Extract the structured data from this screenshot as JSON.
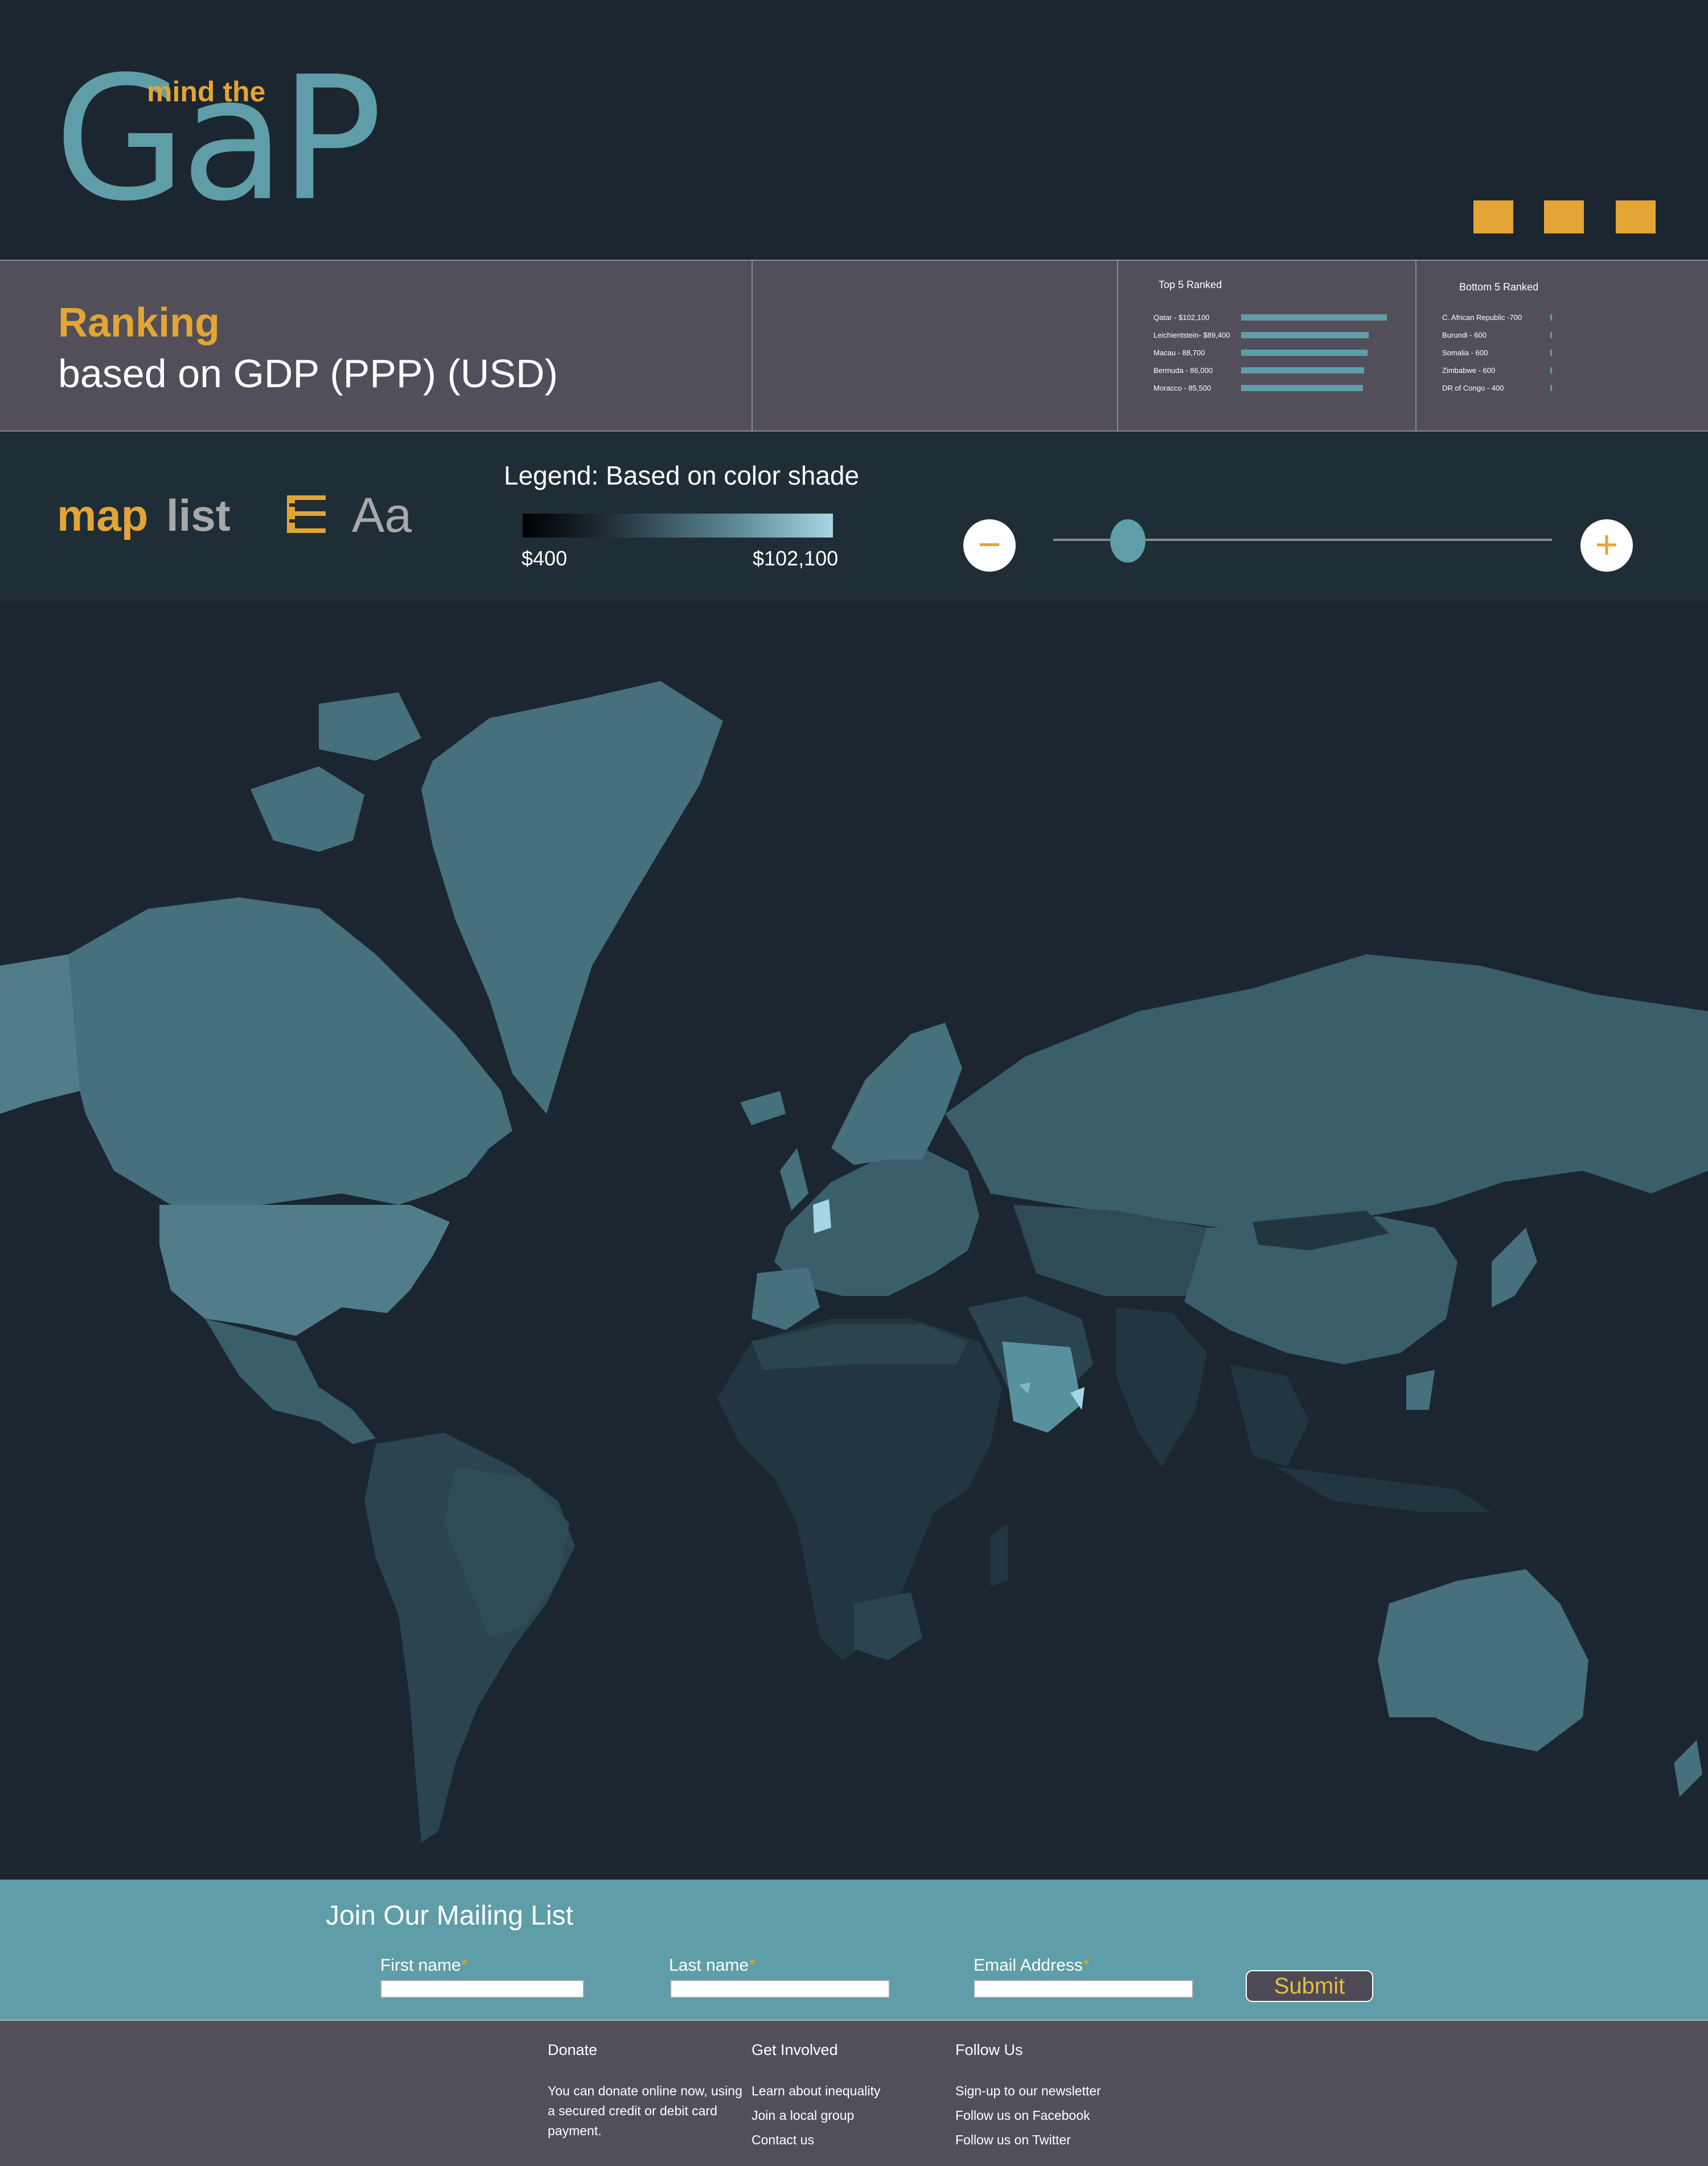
{
  "header": {
    "logo_main": "GaP",
    "logo_small": "mind the",
    "square_color": "#e3a535"
  },
  "ranking": {
    "title": "Ranking",
    "subtitle": "based on GDP (PPP) (USD)",
    "top": {
      "title": "Top 5 Ranked",
      "items": [
        {
          "label": "Qatar - $102,100",
          "value": 102100
        },
        {
          "label": "Leichientstein- $89,400",
          "value": 89400
        },
        {
          "label": "Macau - 88,700",
          "value": 88700
        },
        {
          "label": "Bermuda - 86,000",
          "value": 86000
        },
        {
          "label": "Moracco - 85,500",
          "value": 85500
        }
      ]
    },
    "bottom": {
      "title": "Bottom 5 Ranked",
      "items": [
        {
          "label": "C. African Republic -700",
          "value": 700
        },
        {
          "label": "Burundi - 600",
          "value": 600
        },
        {
          "label": "Somalia - 600",
          "value": 600
        },
        {
          "label": "Zimbabwe - 600",
          "value": 600
        },
        {
          "label": "DR of Congo - 400",
          "value": 400
        }
      ]
    }
  },
  "toolbar": {
    "tab_map": "map",
    "tab_list": "list",
    "text_size_label": "Aa",
    "legend": {
      "title": "Legend: Based on color shade",
      "min": "$400",
      "max": "$102,100"
    },
    "zoom_out": "−",
    "zoom_in": "+",
    "zoom_level": 0.15
  },
  "map": {
    "land_colors": [
      "#45707c",
      "#3a5f6a",
      "#2a454f",
      "#233740",
      "#58919e",
      "#7fb8c6",
      "#a6d6e6"
    ]
  },
  "mailing": {
    "title": "Join Our Mailing List",
    "first_name": "First name",
    "last_name": "Last name",
    "email": "Email Address",
    "required_mark": "*",
    "submit": "Submit"
  },
  "footer": {
    "donate": {
      "title": "Donate",
      "lines": [
        "You can donate online now, using",
        "a secured credit or debit card",
        "payment."
      ]
    },
    "involved": {
      "title": "Get Involved",
      "links": [
        "Learn about inequality",
        "Join a local group",
        "Contact us"
      ]
    },
    "follow": {
      "title": "Follow Us",
      "links": [
        "Sign-up to our newsletter",
        "Follow us on Facebook",
        "Follow us on Twitter"
      ]
    }
  }
}
